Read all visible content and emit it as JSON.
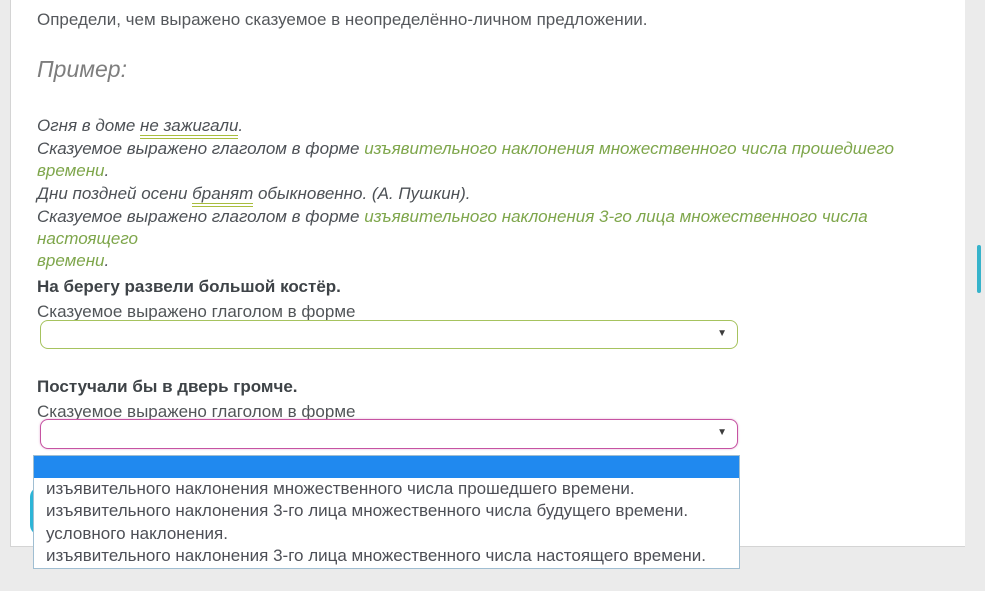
{
  "page": {
    "instruction": "Определи, чем выражено сказуемое в неопределённо-личном предложении.",
    "example_heading": "Пример:",
    "examples": [
      {
        "sentence_prefix": "Огня в доме ",
        "predicate": "не зажигали",
        "sentence_suffix": ".",
        "explain_prefix": "Сказуемое выражено глаголом в форме ",
        "explain_green": "изъявительного наклонения множественного числа прошедшего времени",
        "explain_suffix": "."
      },
      {
        "sentence_prefix": "Дни поздней осени ",
        "predicate": "бранят",
        "sentence_suffix": " обыкновенно. (А. Пушкин).",
        "explain_prefix": "Сказуемое выражено глаголом в форме ",
        "explain_green_line1": "изъявительного наклонения 3-го лица множественного числа настоящего",
        "explain_green_line2": "времени",
        "explain_suffix": "."
      }
    ],
    "questions": [
      {
        "sentence": "На берегу развели большой костёр.",
        "prompt": "Сказуемое выражено глаголом в форме",
        "selected_value": ""
      },
      {
        "sentence": "Постучали бы в дверь громче.",
        "prompt": "Сказуемое выражено глаголом в форме",
        "selected_value": ""
      }
    ],
    "dropdown_options": [
      "",
      "изъявительного наклонения множественного числа прошедшего времени.",
      "изъявительного наклонения 3-го лица множественного числа будущего времени.",
      "условного наклонения.",
      "изъявительного наклонения 3-го лица множественного числа настоящего времени."
    ],
    "icons": {
      "dropdown_arrow": "▼"
    },
    "colors": {
      "accent_green_text": "#7ea64b",
      "underline_green": "#a9bd3d",
      "select_valid_border": "#a6c35f",
      "select_focus_border": "#c653a2",
      "option_highlight_blue": "#2089ef",
      "answer_button_cyan": "#2cb5d7",
      "scrollbar_thumb_cyan": "#36b3cb",
      "page_background": "#ebebeb"
    }
  }
}
